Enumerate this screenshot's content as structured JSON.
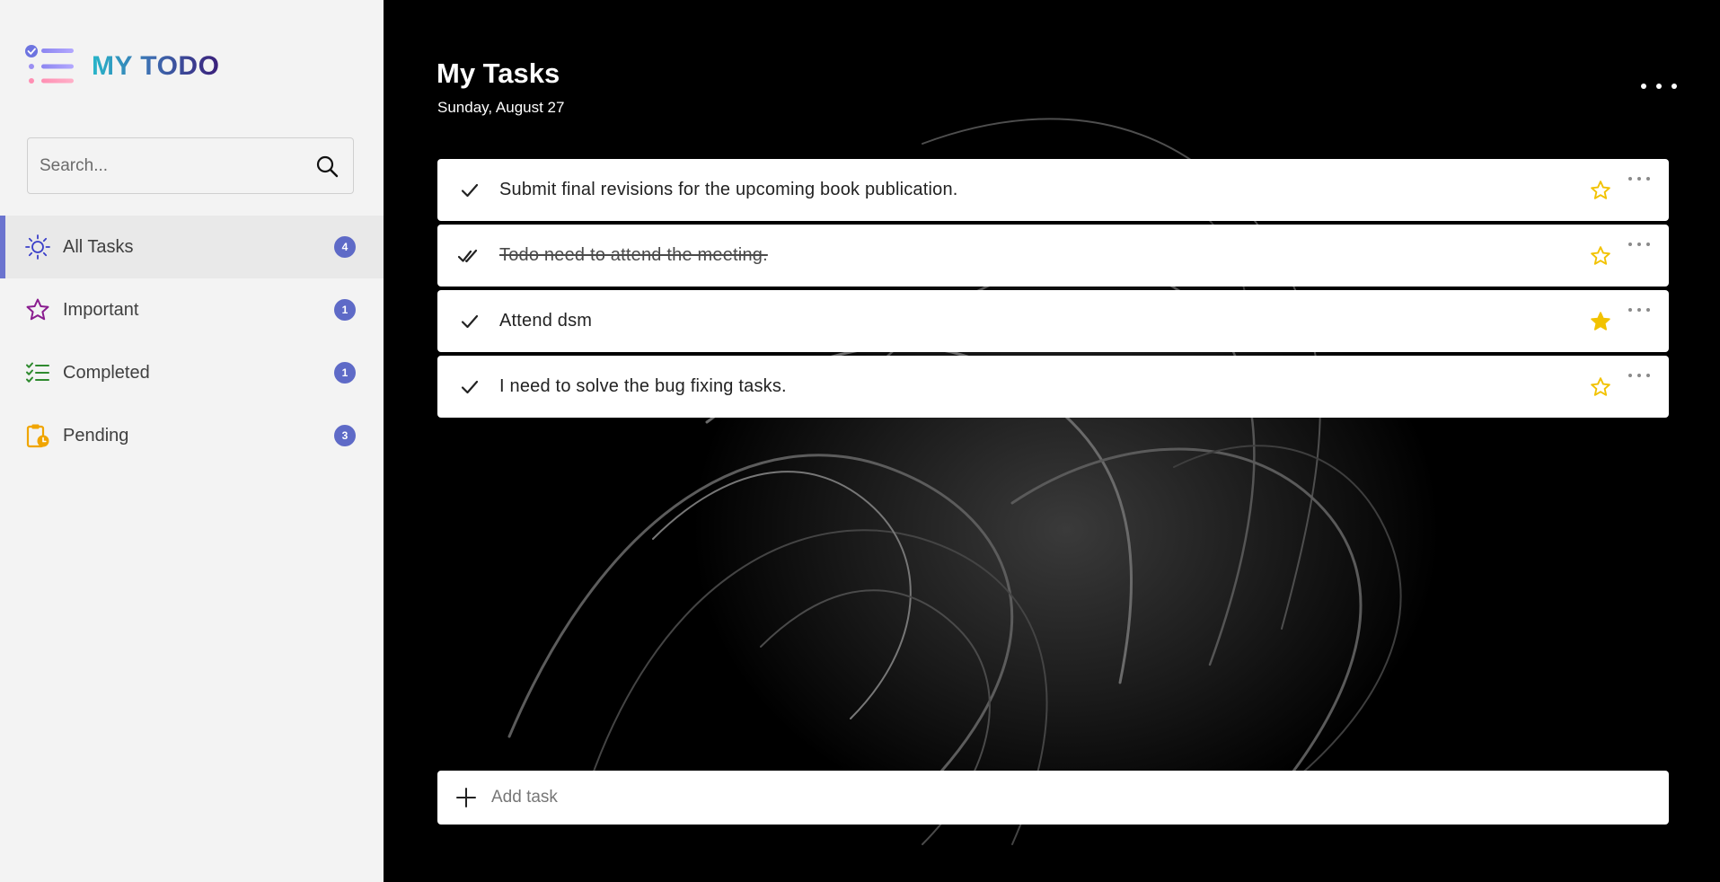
{
  "app": {
    "name": "MY TODO"
  },
  "search": {
    "placeholder": "Search..."
  },
  "sidebar": {
    "items": [
      {
        "label": "All Tasks",
        "count": "4",
        "icon": "sun-icon",
        "active": true
      },
      {
        "label": "Important",
        "count": "1",
        "icon": "star-icon",
        "active": false
      },
      {
        "label": "Completed",
        "count": "1",
        "icon": "checklist-icon",
        "active": false
      },
      {
        "label": "Pending",
        "count": "3",
        "icon": "clipboard-clock-icon",
        "active": false
      }
    ]
  },
  "main": {
    "title": "My Tasks",
    "date": "Sunday, August 27",
    "tasks": [
      {
        "text": "Submit final revisions for the upcoming book publication.",
        "completed": false,
        "important": false
      },
      {
        "text": "Todo need to attend the meeting.",
        "completed": true,
        "important": false
      },
      {
        "text": "Attend dsm",
        "completed": false,
        "important": true
      },
      {
        "text": "I need to solve the bug fixing tasks.",
        "completed": false,
        "important": false
      }
    ],
    "add_task_placeholder": "Add task"
  },
  "colors": {
    "accent": "#5e6ac7",
    "star": "#f2c200",
    "sidebar_bg": "#f3f3f3"
  }
}
